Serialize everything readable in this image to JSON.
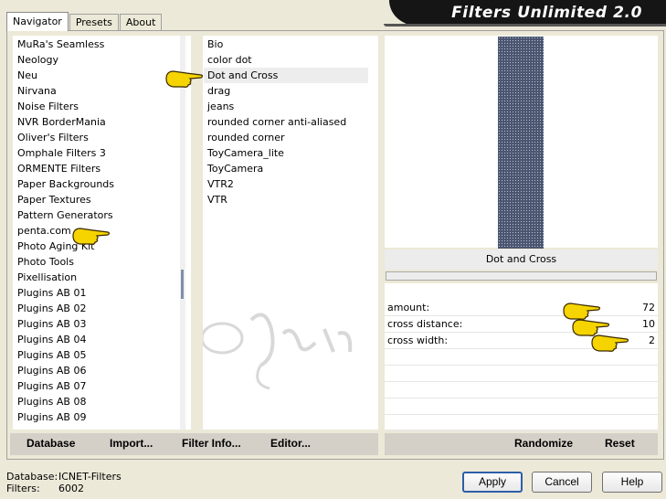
{
  "tabs": [
    "Navigator",
    "Presets",
    "About"
  ],
  "banner": "Filters Unlimited 2.0",
  "categories": [
    "MuRa's Seamless",
    "Neology",
    "Neu",
    "Nirvana",
    "Noise Filters",
    "NVR BorderMania",
    "Oliver's Filters",
    "Omphale Filters 3",
    "ORMENTE Filters",
    "Paper Backgrounds",
    "Paper Textures",
    "Pattern Generators",
    "penta.com",
    "Photo Aging Kit",
    "Photo Tools",
    "Pixellisation",
    "Plugins AB 01",
    "Plugins AB 02",
    "Plugins AB 03",
    "Plugins AB 04",
    "Plugins AB 05",
    "Plugins AB 06",
    "Plugins AB 07",
    "Plugins AB 08",
    "Plugins AB 09"
  ],
  "selected_category": "penta.com",
  "filters": [
    "Bio",
    "color dot",
    "Dot and Cross",
    "drag",
    "jeans",
    "rounded corner anti-aliased",
    "rounded corner",
    "ToyCamera_lite",
    "ToyCamera",
    "VTR2",
    "VTR"
  ],
  "selected_filter": "Dot and Cross",
  "left_buttons": {
    "database": "Database",
    "import": "Import...",
    "filter_info": "Filter Info...",
    "editor": "Editor..."
  },
  "right_buttons": {
    "randomize": "Randomize",
    "reset": "Reset"
  },
  "filter_title": "Dot and Cross",
  "params": [
    {
      "label": "amount:",
      "value": "72"
    },
    {
      "label": "cross distance:",
      "value": "10"
    },
    {
      "label": "cross width:",
      "value": "2"
    }
  ],
  "footer": {
    "db_label": "Database:",
    "db_value": "ICNET-Filters",
    "filters_label": "Filters:",
    "filters_value": "6002"
  },
  "dialog_buttons": {
    "apply": "Apply",
    "cancel": "Cancel",
    "help": "Help"
  },
  "icons": [
    "pointing-hand-icon"
  ],
  "colors": {
    "banner_bg": "#151515",
    "hand_fill": "#f5d400",
    "default_border": "#2c5fa8"
  }
}
